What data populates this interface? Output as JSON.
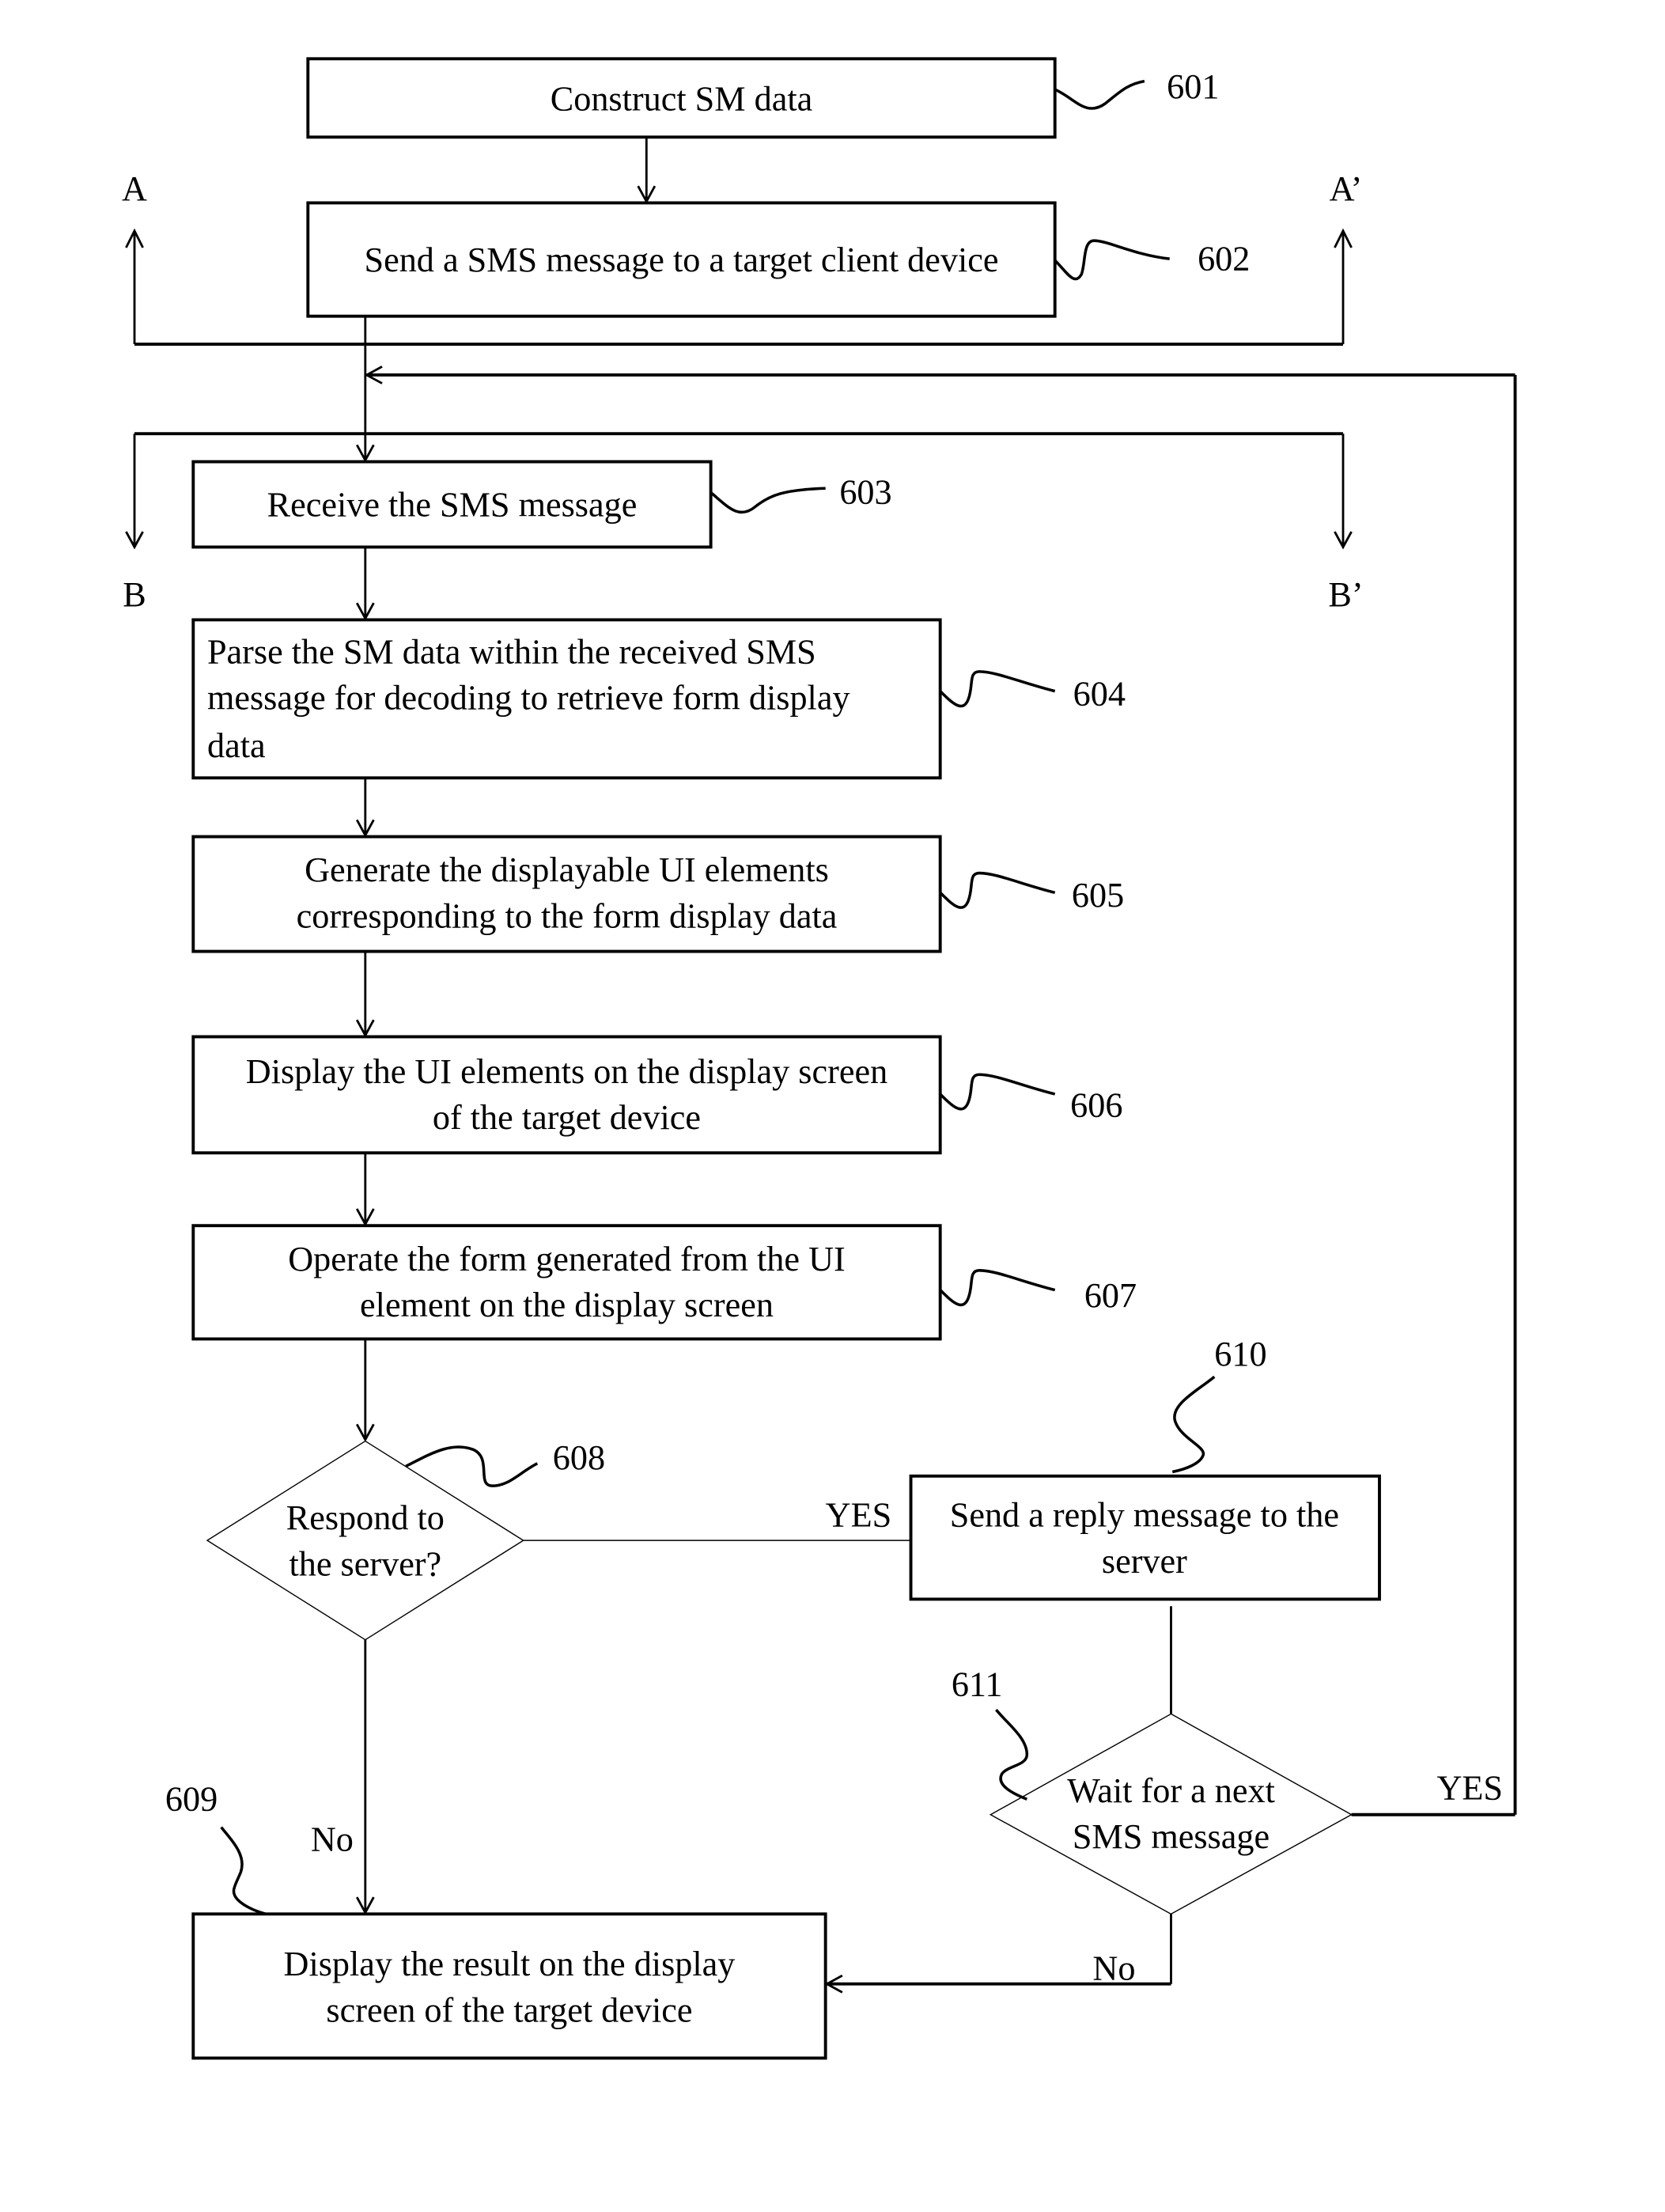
{
  "figure": {
    "steps": {
      "s601": {
        "ref": "601",
        "lines": [
          "Construct SM data"
        ]
      },
      "s602": {
        "ref": "602",
        "lines": [
          "Send a SMS message to a target client device"
        ]
      },
      "s603": {
        "ref": "603",
        "lines": [
          "Receive the SMS message"
        ]
      },
      "s604": {
        "ref": "604",
        "lines": [
          "Parse the SM data within the received SMS",
          "message for decoding to retrieve form display",
          "data"
        ]
      },
      "s605": {
        "ref": "605",
        "lines": [
          "Generate the displayable UI elements",
          "corresponding to the form display data"
        ]
      },
      "s606": {
        "ref": "606",
        "lines": [
          "Display the UI elements on the display screen",
          "of the target device"
        ]
      },
      "s607": {
        "ref": "607",
        "lines": [
          "Operate the form generated from the UI",
          "element on the display screen"
        ]
      },
      "s608": {
        "ref": "608",
        "lines": [
          "Respond to",
          "the server?"
        ]
      },
      "s609": {
        "ref": "609",
        "lines": [
          "Display the result on the display",
          "screen of the target device"
        ]
      },
      "s610": {
        "ref": "610",
        "lines": [
          "Send a reply message to the",
          "server"
        ]
      },
      "s611": {
        "ref": "611",
        "lines": [
          "Wait for a next",
          "SMS message"
        ]
      }
    },
    "connectors": {
      "a": "A",
      "a_prime": "A’",
      "b": "B",
      "b_prime": "B’"
    },
    "branch_labels": {
      "s608_yes": "YES",
      "s608_no": "No",
      "s611_yes": "YES",
      "s611_no": "No"
    }
  }
}
